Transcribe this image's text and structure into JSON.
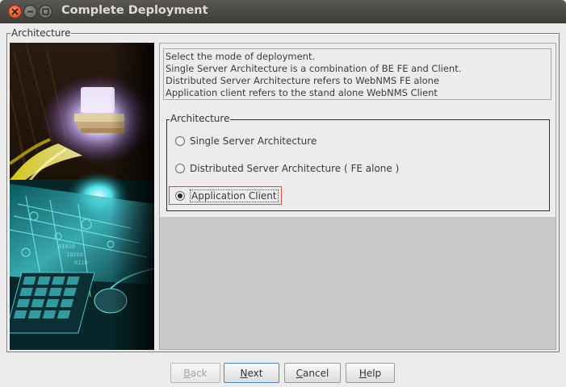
{
  "window": {
    "title": "Complete Deployment"
  },
  "outer_group": {
    "legend": "Architecture"
  },
  "description": {
    "lines": [
      "Select the mode of deployment.",
      "Single Server Architecture is a combination of BE FE and Client.",
      "Distributed Server Architecture refers to WebNMS FE alone",
      "Application client refers to the stand alone WebNMS Client"
    ]
  },
  "architecture": {
    "legend": "Architecture",
    "options": [
      {
        "label": "Single Server Architecture",
        "selected": false
      },
      {
        "label": "Distributed Server Architecture ( FE alone )",
        "selected": false
      },
      {
        "label": "Application Client",
        "selected": true
      }
    ]
  },
  "buttons": {
    "back": {
      "mnemonic": "B",
      "rest": "ack",
      "enabled": false
    },
    "next": {
      "mnemonic": "N",
      "rest": "ext",
      "enabled": true
    },
    "cancel": {
      "mnemonic": "C",
      "rest": "ancel",
      "enabled": true
    },
    "help": {
      "mnemonic": "H",
      "rest": "elp",
      "enabled": true
    }
  },
  "colors": {
    "titlebar": "#3d3c38",
    "close_button": "#d6451b",
    "focus_highlight": "#e04848",
    "image_glow": "#4fe0e8"
  }
}
